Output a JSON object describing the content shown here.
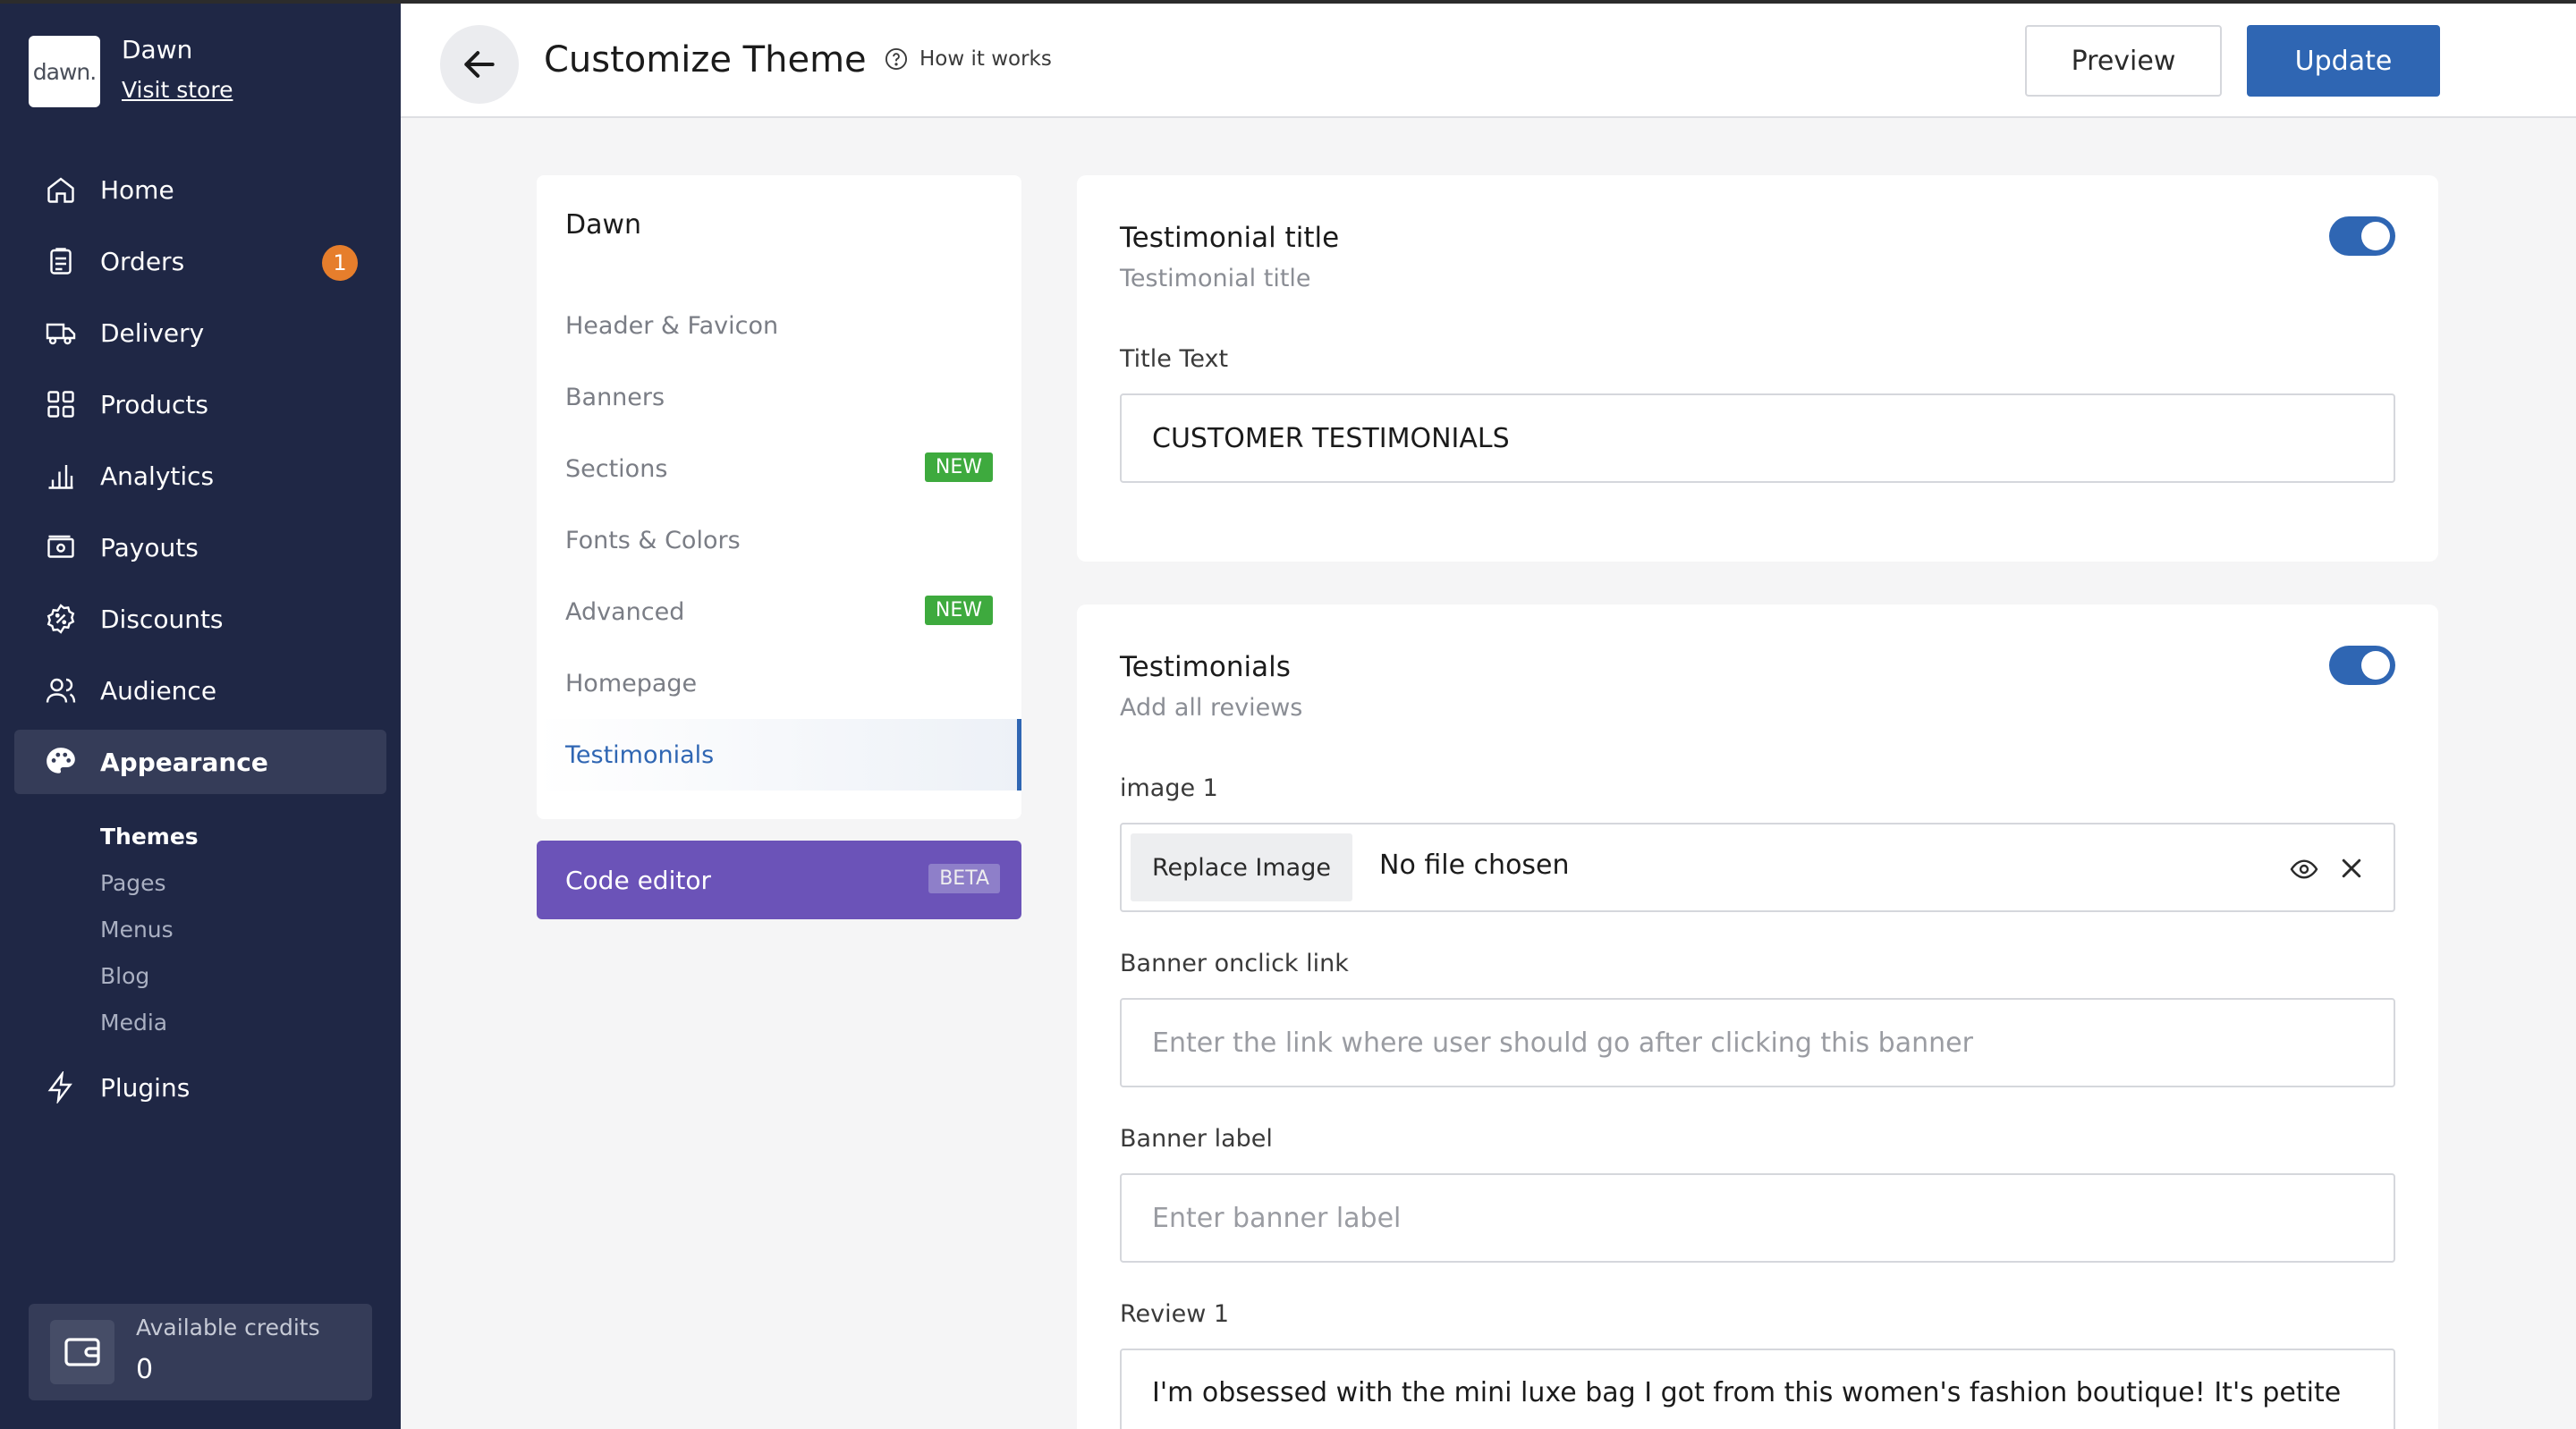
{
  "store": {
    "logo_text": "dawn.",
    "name": "Dawn",
    "visit_label": "Visit store"
  },
  "nav": [
    {
      "label": "Home",
      "icon": "home-icon"
    },
    {
      "label": "Orders",
      "icon": "clipboard-icon",
      "badge": "1"
    },
    {
      "label": "Delivery",
      "icon": "truck-icon"
    },
    {
      "label": "Products",
      "icon": "grid-icon"
    },
    {
      "label": "Analytics",
      "icon": "bar-chart-icon"
    },
    {
      "label": "Payouts",
      "icon": "payout-icon"
    },
    {
      "label": "Discounts",
      "icon": "discount-icon"
    },
    {
      "label": "Audience",
      "icon": "users-icon"
    },
    {
      "label": "Appearance",
      "icon": "palette-icon"
    }
  ],
  "appearance_sub": [
    "Themes",
    "Pages",
    "Menus",
    "Blog",
    "Media"
  ],
  "plugins_label": "Plugins",
  "credits": {
    "label": "Available credits",
    "value": "0"
  },
  "header": {
    "title": "Customize Theme",
    "how": "How it works",
    "preview": "Preview",
    "update": "Update"
  },
  "theme_menu": {
    "title": "Dawn",
    "items": [
      {
        "label": "Header & Favicon"
      },
      {
        "label": "Banners"
      },
      {
        "label": "Sections",
        "tag": "NEW"
      },
      {
        "label": "Fonts & Colors"
      },
      {
        "label": "Advanced",
        "tag": "NEW"
      },
      {
        "label": "Homepage"
      },
      {
        "label": "Testimonials"
      }
    ],
    "code_editor": "Code editor",
    "code_tag": "BETA"
  },
  "testimonial_title_card": {
    "title": "Testimonial title",
    "subtitle": "Testimonial title",
    "enabled": true,
    "field_label": "Title Text",
    "field_value": "CUSTOMER TESTIMONIALS"
  },
  "testimonials_card": {
    "title": "Testimonials",
    "subtitle": "Add all reviews",
    "enabled": true,
    "image_label": "image 1",
    "replace_label": "Replace Image",
    "file_status": "No file chosen",
    "link_label": "Banner onclick link",
    "link_placeholder": "Enter the link where user should go after clicking this banner",
    "banner_label": "Banner label",
    "banner_placeholder": "Enter banner label",
    "review_label": "Review 1",
    "review_text": "I'm obsessed with the mini luxe bag I got from this women's fashion boutique! It's petite"
  },
  "colors": {
    "sidebar": "#1f2745",
    "accent": "#2f66b3",
    "badge": "#e67e2c",
    "new_tag": "#3eaa3e",
    "code_editor": "#6b53b8"
  }
}
